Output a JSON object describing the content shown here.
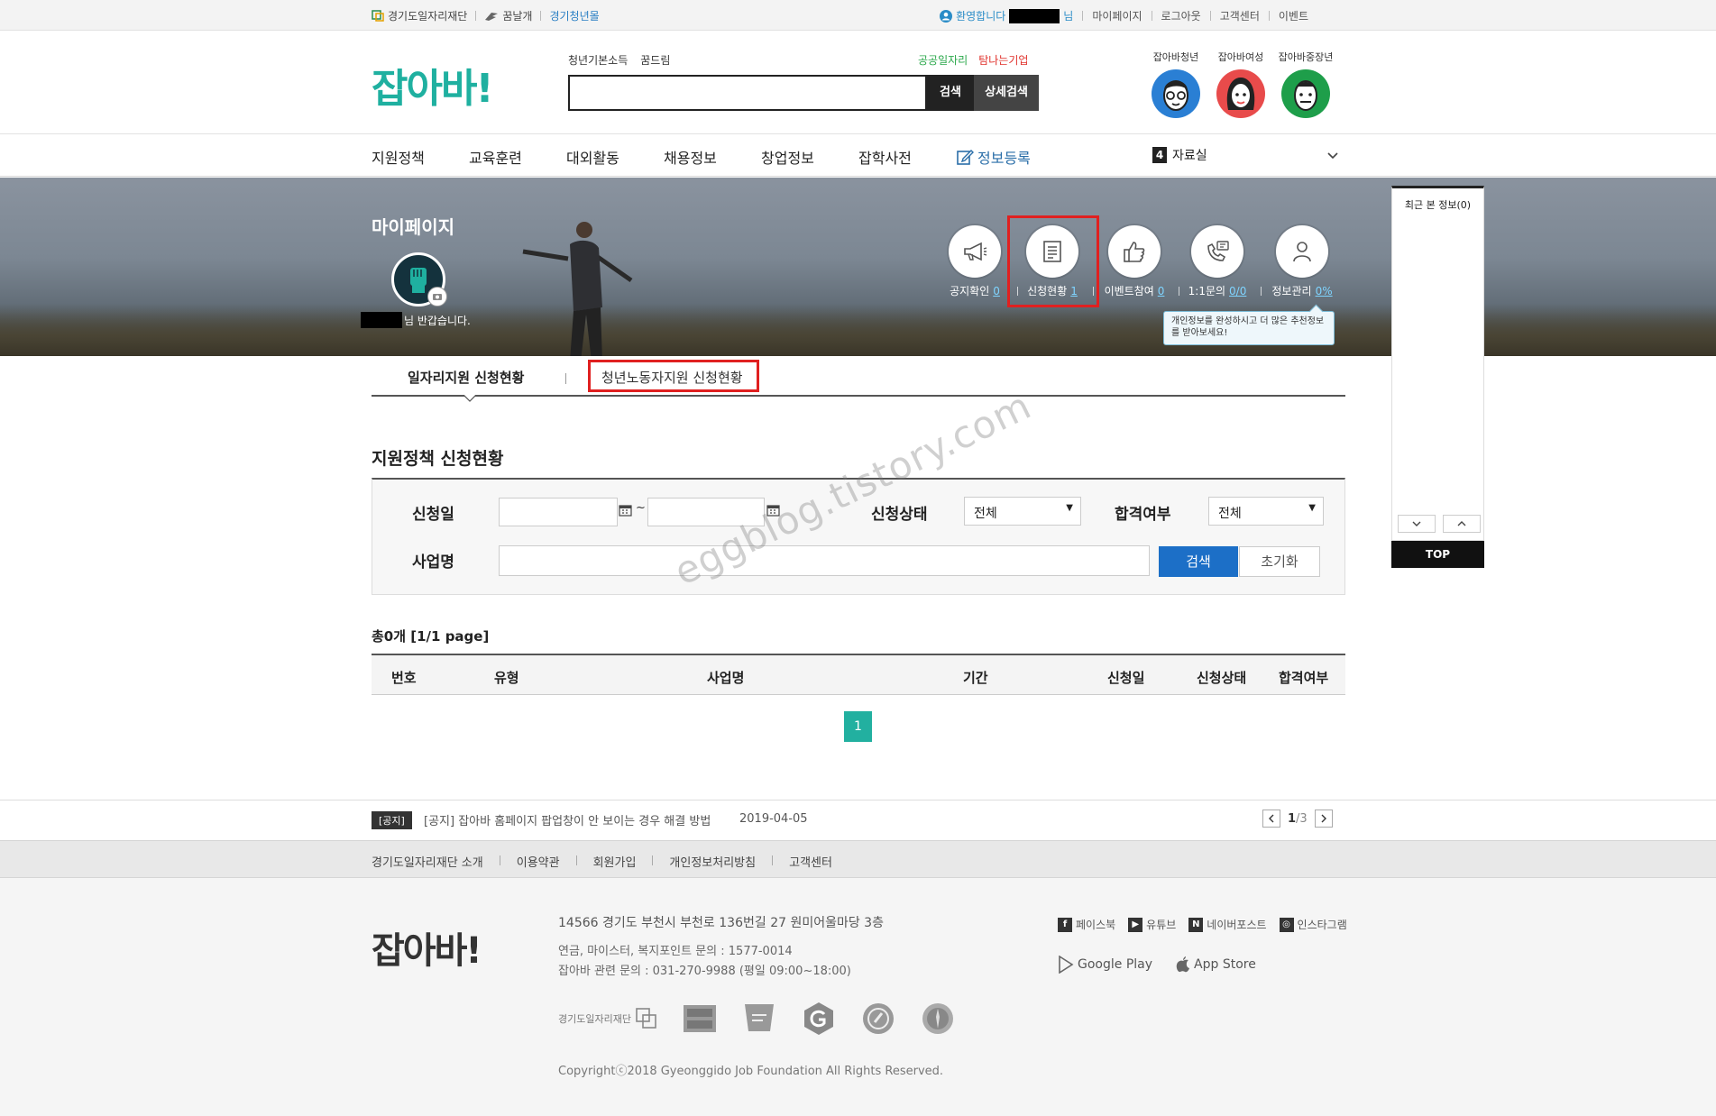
{
  "topbar": {
    "links_left": [
      "경기도일자리재단",
      "꿈날개",
      "경기청년몰"
    ],
    "welcome": "환영합니다",
    "welcome_suffix": "님",
    "links_right": [
      "마이페이지",
      "로그아웃",
      "고객센터",
      "이벤트"
    ]
  },
  "header": {
    "logo": "잡아바!",
    "quick_links": [
      "청년기본소득",
      "꿈드림"
    ],
    "quick_links_right": [
      {
        "label": "공공일자리",
        "color": "#2aa84a"
      },
      {
        "label": "탐나는기업",
        "color": "#e0302a"
      }
    ],
    "search_button": "검색",
    "detail_search_button": "상세검색",
    "characters": [
      {
        "label": "잡아바청년",
        "color": "#2a7fd4"
      },
      {
        "label": "잡아바여성",
        "color": "#e84b4b"
      },
      {
        "label": "잡아바중장년",
        "color": "#1e9e4a"
      }
    ]
  },
  "nav": {
    "items": [
      "지원정책",
      "교육훈련",
      "대외활동",
      "채용정보",
      "창업정보",
      "잡학사전"
    ],
    "register": "정보등록",
    "data_room_num": "4",
    "data_room": "자료실"
  },
  "hero": {
    "title": "마이페이지",
    "greeting": "님 반갑습니다.",
    "quick": [
      {
        "label": "공지확인",
        "count": "0"
      },
      {
        "label": "신청현황",
        "count": "1"
      },
      {
        "label": "이벤트참여",
        "count": "0"
      },
      {
        "label": "1:1문의",
        "count": "0/0"
      },
      {
        "label": "정보관리",
        "count": "0%"
      }
    ],
    "tooltip": "개인정보를 완성하시고 더 많은 추천정보를 받아보세요!"
  },
  "sidebar": {
    "recent": "최근 본 정보(0)",
    "top": "TOP"
  },
  "tabs": {
    "tab1": "일자리지원 신청현황",
    "tab2": "청년노동자지원 신청현황"
  },
  "section": {
    "title": "지원정책 신청현황"
  },
  "filter": {
    "date_label": "신청일",
    "tilde": "~",
    "status_label": "신청상태",
    "status_value": "전체",
    "pass_label": "합격여부",
    "pass_value": "전체",
    "name_label": "사업명",
    "search": "검색",
    "reset": "초기화"
  },
  "results": {
    "total": "총0개 [1/1 page]",
    "columns": [
      "번호",
      "유형",
      "사업명",
      "기간",
      "신청일",
      "신청상태",
      "합격여부"
    ],
    "page": "1"
  },
  "notice": {
    "tag": "[공지]",
    "text": "[공지] 잡아바 홈페이지 팝업창이 안 보이는 경우 해결 방법",
    "date": "2019-04-05",
    "page_current": "1",
    "page_total": "/3"
  },
  "footer": {
    "links": [
      "경기도일자리재단 소개",
      "이용약관",
      "회원가입",
      "개인정보처리방침",
      "고객센터"
    ],
    "logo": "잡아바!",
    "address": "14566 경기도 부천시 부천로 136번길 27 원미어울마당 3층",
    "info1": "연금, 마이스터, 복지포인트 문의 : 1577-0014",
    "info2": "잡아바 관련 문의 : 031-270-9988 (평일 09:00~18:00)",
    "social": [
      "페이스북",
      "유튜브",
      "네이버포스트",
      "인스타그램"
    ],
    "stores": [
      "Google Play",
      "App Store"
    ],
    "badge1": "경기도일자리재단",
    "copyright": "Copyrightⓒ2018 Gyeonggido Job Foundation All Rights Reserved."
  },
  "watermark": "eggblog.tistory.com"
}
